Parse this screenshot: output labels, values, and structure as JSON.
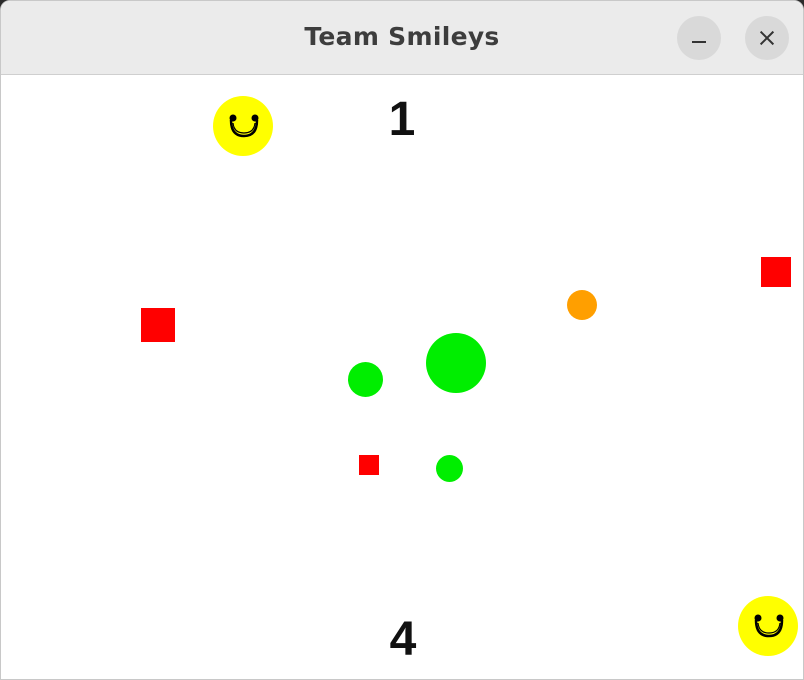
{
  "window": {
    "title": "Team Smileys"
  },
  "scores": {
    "top": "1",
    "bottom": "4"
  },
  "colors": {
    "smiley": "#ffff00",
    "square": "#ff0000",
    "ball_green": "#00ee00",
    "ball_orange": "#ff9f00"
  },
  "icons": {
    "minimize": "minimize-icon",
    "close": "close-icon"
  }
}
